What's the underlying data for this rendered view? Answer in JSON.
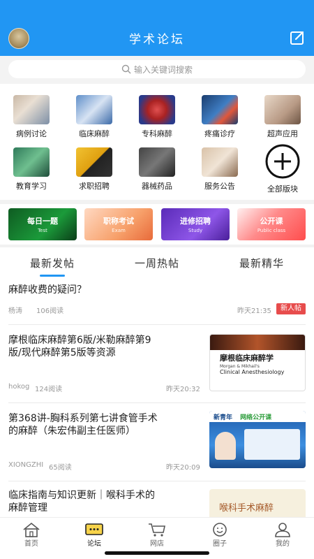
{
  "header": {
    "title": "学术论坛"
  },
  "search": {
    "placeholder": "输入关键词搜索"
  },
  "categories": [
    {
      "label": "病例讨论"
    },
    {
      "label": "临床麻醉"
    },
    {
      "label": "专科麻醉"
    },
    {
      "label": "疼痛诊疗"
    },
    {
      "label": "超声应用"
    },
    {
      "label": "教育学习"
    },
    {
      "label": "求职招聘"
    },
    {
      "label": "器械药品"
    },
    {
      "label": "服务公告"
    },
    {
      "label": "全部版块"
    }
  ],
  "banners": [
    {
      "title": "每日一题",
      "sub": "Test",
      "color": "#1b9a3a"
    },
    {
      "title": "职称考试",
      "sub": "Exam",
      "color": "#f08a5d"
    },
    {
      "title": "进修招聘",
      "sub": "Study",
      "color": "#7b3fd6"
    },
    {
      "title": "公开课",
      "sub": "Public class",
      "color": "#ff5a5a"
    }
  ],
  "tabs": [
    "最新发帖",
    "一周热帖",
    "最新精华"
  ],
  "posts": [
    {
      "title_lines": [
        "麻醉收费的疑问？"
      ],
      "author": "杨涛",
      "reads": "106阅读",
      "time": "昨天21:35",
      "badge": "新人帖"
    },
    {
      "title_lines": [
        "摩根临床麻醉第6版/米勒麻醉第9",
        "版/现代麻醉第5版等资源"
      ],
      "author": "hokog",
      "reads": "124阅读",
      "time": "昨天20:32",
      "image_text": {
        "cn": "摩根临床麻醉学",
        "en_top": "Morgan & Mikhail's",
        "en": "Clinical Anesthesiology"
      }
    },
    {
      "title_lines": [
        "第368讲-胸科系列第七讲食管手术",
        "的麻醉（朱宏伟副主任医师）"
      ],
      "author": "XIONGZHI",
      "reads": "65阅读",
      "time": "昨天20:09",
      "image_text": {
        "brand": "新青年",
        "topic": "网络公开课"
      }
    },
    {
      "title_lines": [
        "临床指南与知识更新｜喉科手术的",
        "麻醉管理"
      ],
      "image_text": {
        "cn": "喉科手术麻醉"
      }
    }
  ],
  "tabbar": [
    {
      "label": "首页"
    },
    {
      "label": "论坛"
    },
    {
      "label": "网店"
    },
    {
      "label": "圈子"
    },
    {
      "label": "我的"
    }
  ],
  "colors": {
    "primary": "#2196f3",
    "badge": "#e74c4c"
  }
}
